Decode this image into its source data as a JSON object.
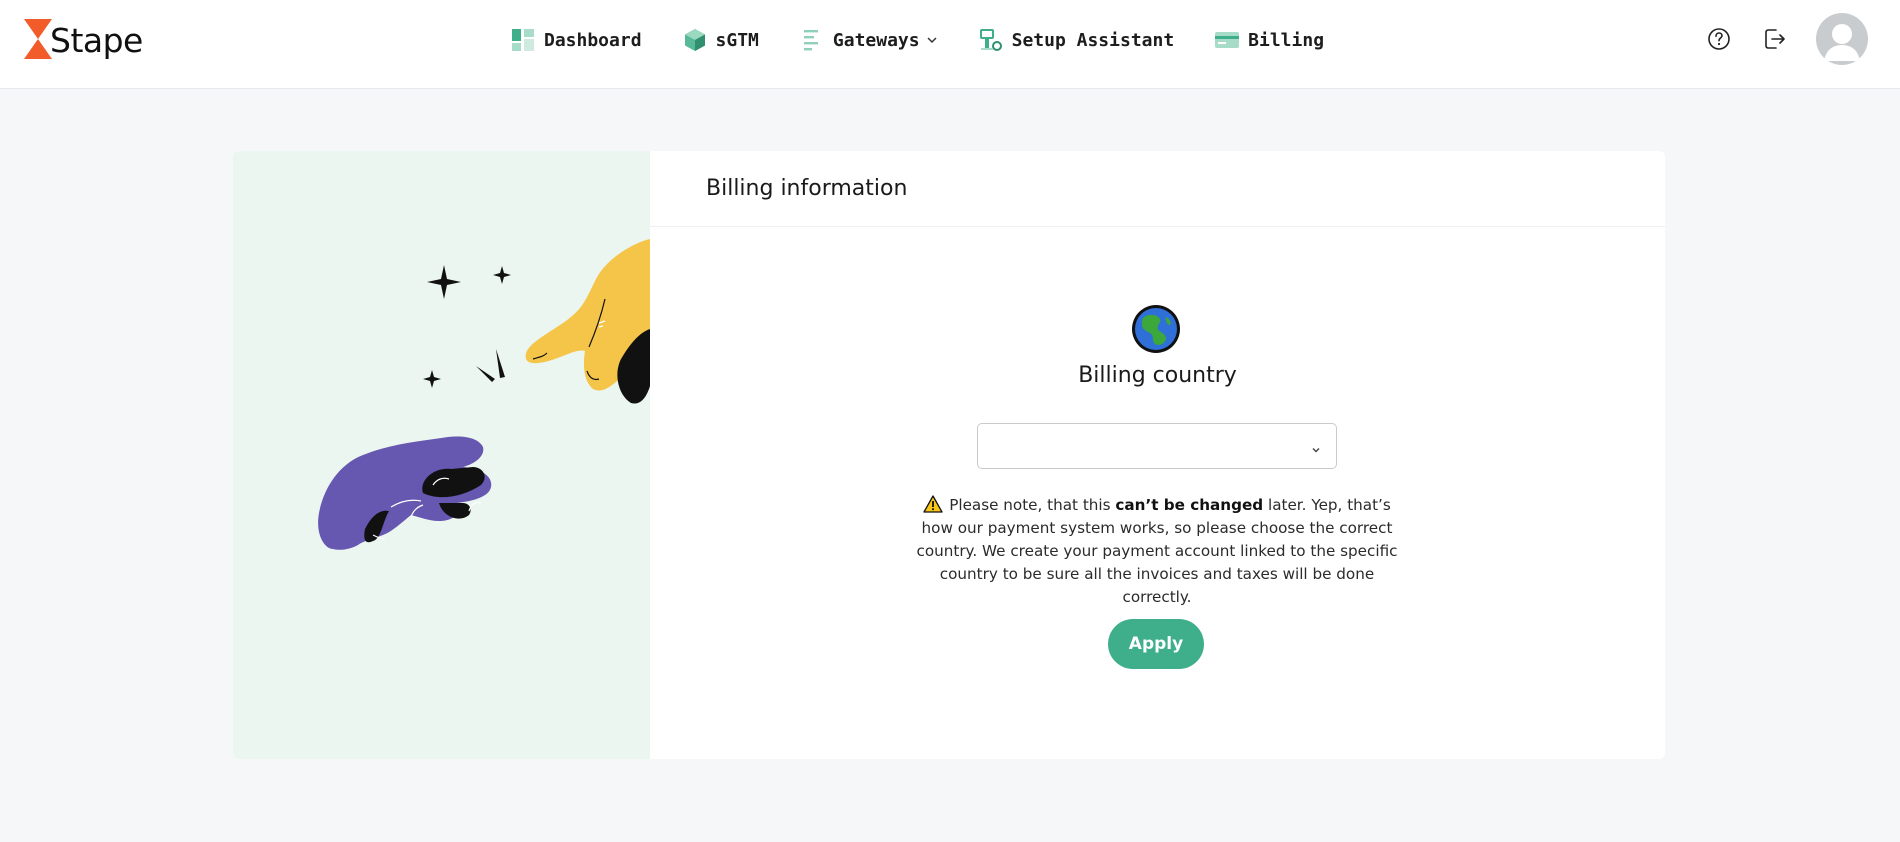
{
  "brand": {
    "logo_text": "Stape",
    "accent_color": "#f25c2a"
  },
  "nav": {
    "items": [
      {
        "label": "Dashboard",
        "icon": "dashboard-icon"
      },
      {
        "label": "sGTM",
        "icon": "cube-icon"
      },
      {
        "label": "Gateways",
        "icon": "list-icon",
        "has_dropdown": true
      },
      {
        "label": "Setup Assistant",
        "icon": "assistant-icon"
      },
      {
        "label": "Billing",
        "icon": "credit-card-icon"
      }
    ]
  },
  "top_actions": {
    "help_icon": "help-icon",
    "logout_icon": "logout-icon",
    "avatar": "avatar-placeholder"
  },
  "billing": {
    "header_title": "Billing information",
    "section_title": "Billing country",
    "country_select": {
      "value": "",
      "icon": "chevron-down-icon"
    },
    "notice_prefix": "Please note, that this ",
    "notice_bold": "can’t be changed",
    "notice_suffix": " later. Yep, that’s how our payment system works, so please choose the correct country. We create your payment account linked to the specific country to be sure all the invoices and taxes will be done correctly.",
    "apply_label": "Apply"
  },
  "colors": {
    "primary_green": "#3fae8a",
    "illustration_bg": "#ebf6f1",
    "page_bg": "#f6f7f8",
    "hand_purple": "#6657b0",
    "hand_yellow": "#f5c54a"
  }
}
